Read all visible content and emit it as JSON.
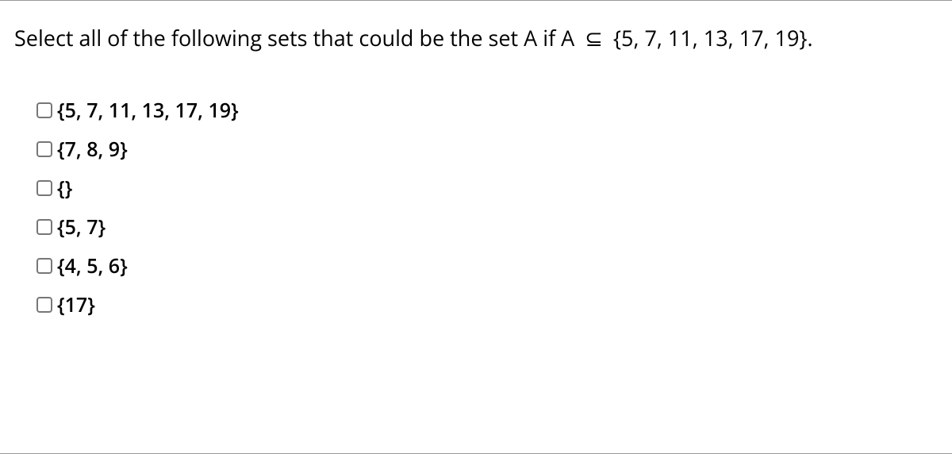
{
  "question": {
    "prefix": "Select all of the following sets that could be the set A if A ",
    "symbol": "⊆",
    "suffix": " {5, 7, 11, 13, 17, 19}."
  },
  "options": [
    {
      "label": "{5, 7, 11, 13, 17, 19}"
    },
    {
      "label": "{7, 8, 9}"
    },
    {
      "label": "{}"
    },
    {
      "label": "{5, 7}"
    },
    {
      "label": "{4, 5, 6}"
    },
    {
      "label": "{17}"
    }
  ]
}
